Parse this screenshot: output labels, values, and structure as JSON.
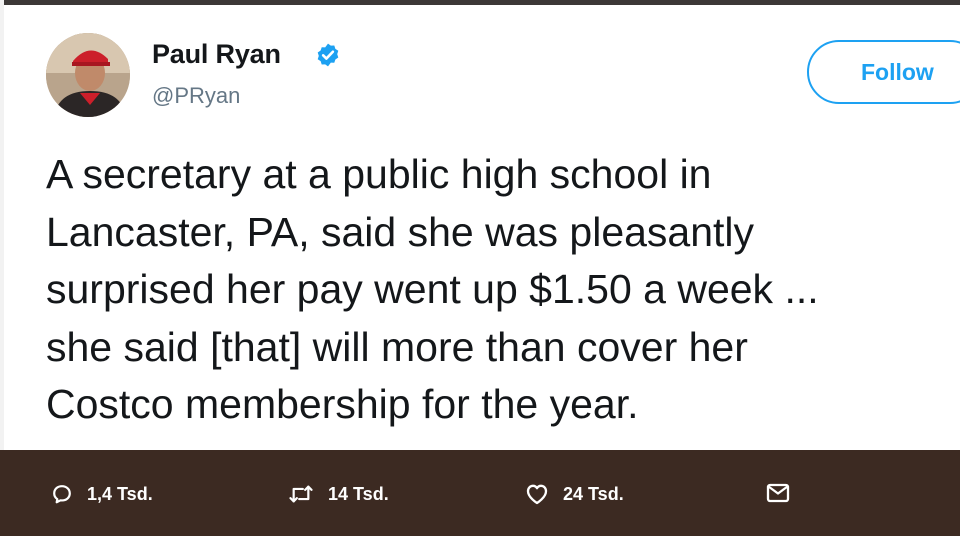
{
  "tweet": {
    "author": {
      "display_name": "Paul Ryan",
      "handle": "@PRyan",
      "verified": true
    },
    "follow_label": "Follow",
    "text_lines": [
      "A secretary at a public high school in",
      "Lancaster, PA, said she was pleasantly",
      "surprised her pay went up $1.50 a week ...",
      "she said [that] will more than cover her",
      "Costco membership for the year."
    ]
  },
  "actions": {
    "replies": "1,4 Tsd.",
    "retweets": "14 Tsd.",
    "likes": "24 Tsd."
  },
  "icons": {
    "verified": "verified-badge-icon",
    "reply": "speech-bubble-icon",
    "retweet": "retweet-arrows-icon",
    "like": "heart-icon",
    "direct_message": "envelope-icon"
  },
  "colors": {
    "accent": "#1da1f2",
    "text": "#14171a",
    "secondary_text": "#657786",
    "action_bar": "#3c2a22"
  }
}
